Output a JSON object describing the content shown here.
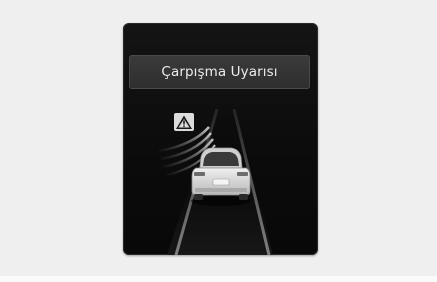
{
  "panel": {
    "title": "Çarpışma Uyarısı"
  },
  "icons": {
    "warning": "warning-triangle-icon",
    "vehicle": "own-vehicle-icon",
    "alert_waves": "collision-alert-waves-icon"
  },
  "colors": {
    "page_background": "#efefef",
    "screen_background": "#111111",
    "title_bar": "#343434",
    "title_text": "#ececec",
    "lane_lines": "#8c8c8c",
    "vehicle_body": "#d9d9d9"
  }
}
